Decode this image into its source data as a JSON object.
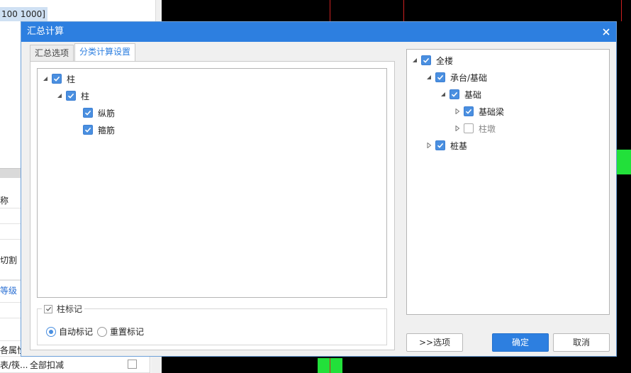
{
  "background": {
    "coord_text": "100 1000]",
    "rows": [
      {
        "text": "称",
        "style": "normal"
      },
      {
        "text": "",
        "style": "normal"
      },
      {
        "text": "",
        "style": "normal"
      },
      {
        "text": "切割",
        "style": "normal"
      },
      {
        "text": "",
        "style": "normal"
      },
      {
        "text": "等级",
        "style": "link"
      },
      {
        "text": "",
        "style": "normal"
      },
      {
        "text": "",
        "style": "normal"
      },
      {
        "text": "各属性",
        "style": "normal"
      },
      {
        "text": "表/筷...",
        "style": "normal"
      }
    ],
    "last_row_value": "全部扣减"
  },
  "dialog": {
    "title": "汇总计算",
    "tabs": [
      {
        "label": "汇总选项",
        "active": false
      },
      {
        "label": "分类计算设置",
        "active": true
      }
    ],
    "left_tree": [
      {
        "label": "柱",
        "checked": true,
        "expanded": true,
        "level": 0
      },
      {
        "label": "柱",
        "checked": true,
        "expanded": true,
        "level": 1
      },
      {
        "label": "纵筋",
        "checked": true,
        "level": 2
      },
      {
        "label": "箍筋",
        "checked": true,
        "level": 2
      }
    ],
    "mark_section": {
      "label": "柱标记",
      "checked": true,
      "options": [
        {
          "label": "自动标记",
          "selected": true
        },
        {
          "label": "重置标记",
          "selected": false
        }
      ]
    },
    "right_tree": [
      {
        "label": "全楼",
        "checked": true,
        "expand": "expanded"
      },
      {
        "label": "承台/基础",
        "checked": true,
        "expand": "expanded"
      },
      {
        "label": "基础",
        "checked": true,
        "expand": "expanded"
      },
      {
        "label": "基础梁",
        "checked": true,
        "expand": "collapsed"
      },
      {
        "label": "柱墩",
        "checked": false,
        "expand": "collapsed"
      },
      {
        "label": "桩基",
        "checked": true,
        "expand": "collapsed"
      }
    ],
    "buttons": {
      "options": ">>选项",
      "ok": "确定",
      "cancel": "取消"
    }
  },
  "colors": {
    "titlebar": "#2d7fe0",
    "checkbox": "#4a8fe0",
    "canvas": "#000000",
    "grid_red": "#cc2020",
    "grid_green": "#22e03a"
  }
}
